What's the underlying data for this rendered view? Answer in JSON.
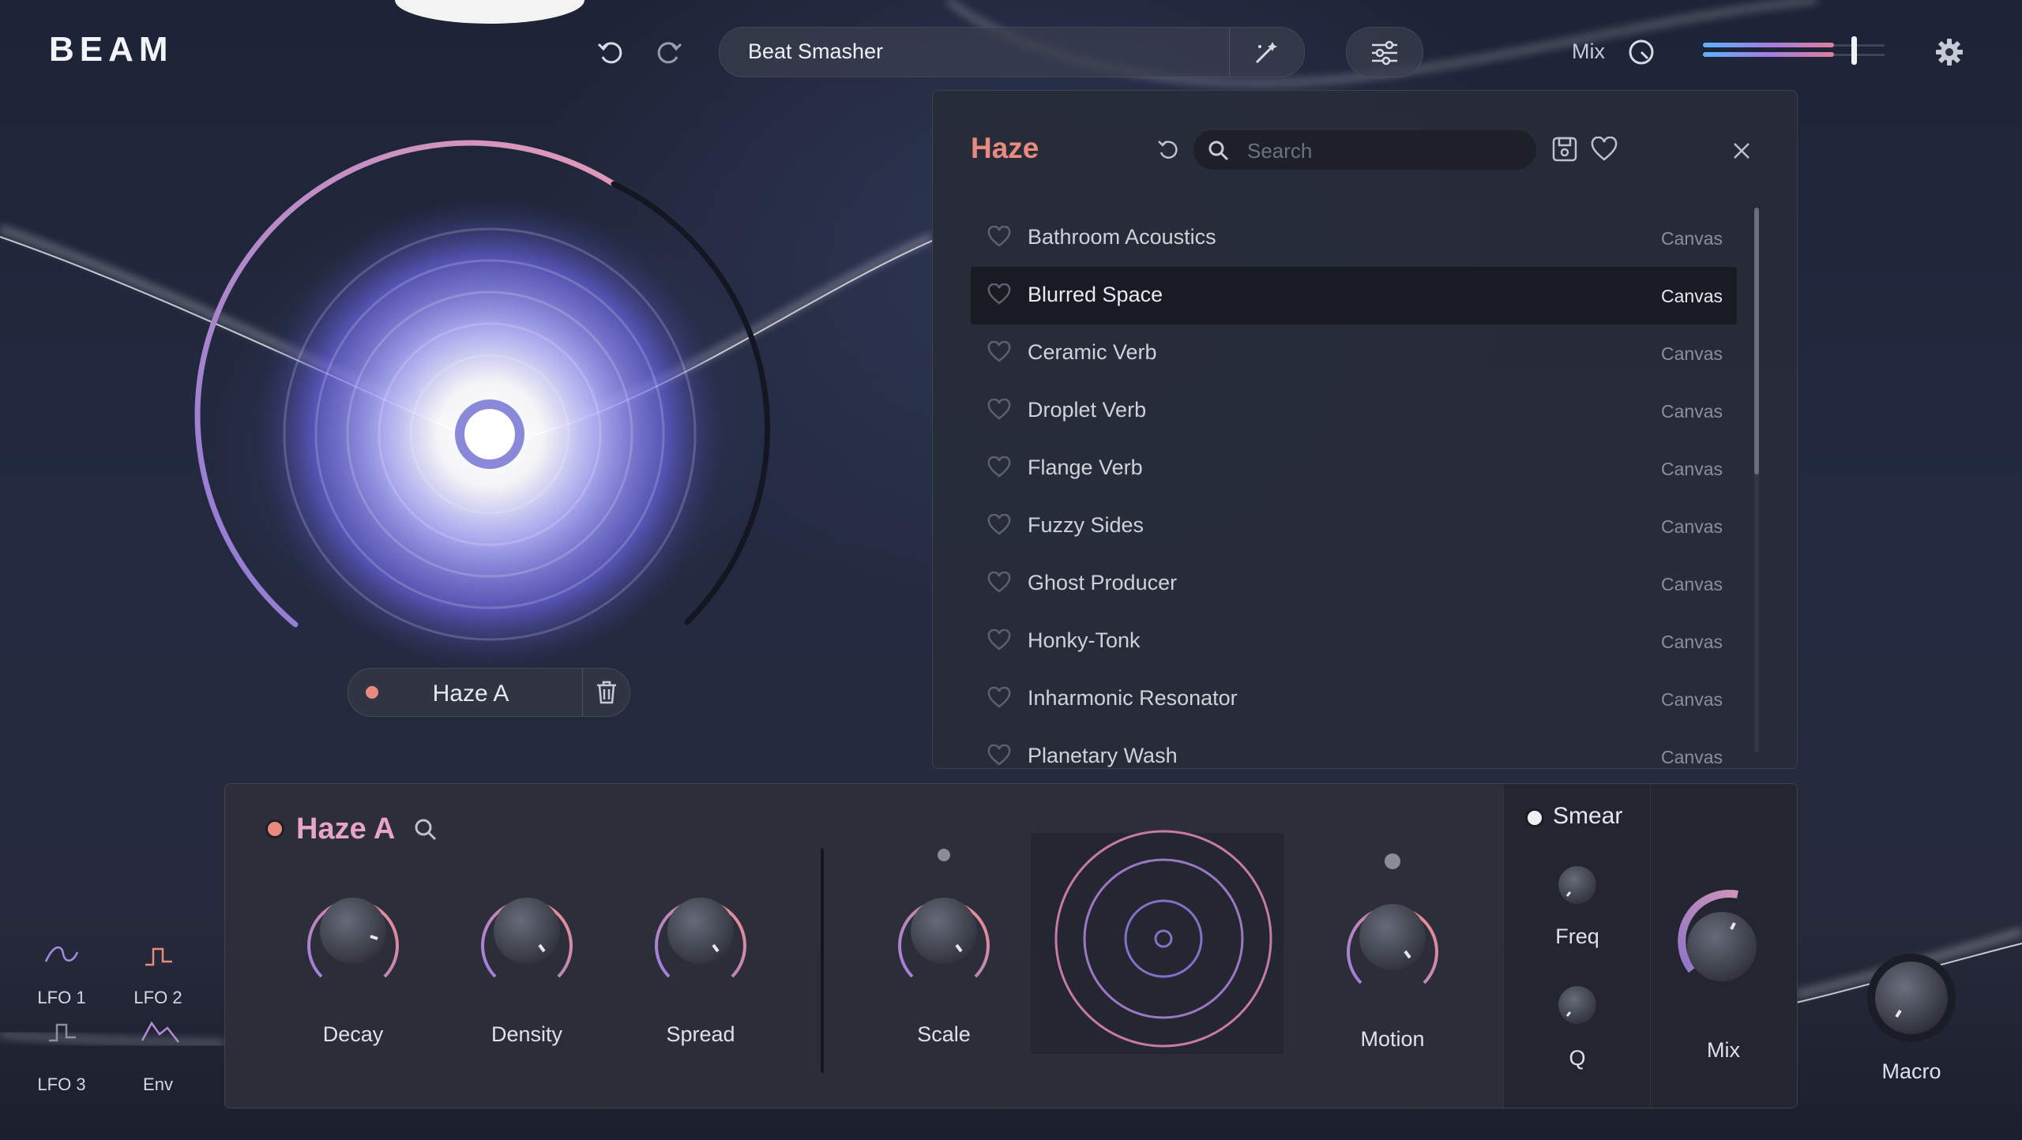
{
  "app": {
    "logo": "BEAM"
  },
  "topbar": {
    "preset_name": "Beat Smasher",
    "mix_label": "Mix",
    "mix_level": 0.85,
    "icons": [
      "undo-icon",
      "redo-icon",
      "magic-wand-icon",
      "sliders-icon",
      "mix-dial-icon",
      "gear-icon"
    ]
  },
  "visualizer": {
    "module_name": "Haze A"
  },
  "browser": {
    "title": "Haze",
    "search_placeholder": "Search",
    "items": [
      {
        "name": "Bathroom Acoustics",
        "tag": "Canvas",
        "selected": false
      },
      {
        "name": "Blurred Space",
        "tag": "Canvas",
        "selected": true
      },
      {
        "name": "Ceramic Verb",
        "tag": "Canvas",
        "selected": false
      },
      {
        "name": "Droplet Verb",
        "tag": "Canvas",
        "selected": false
      },
      {
        "name": "Flange Verb",
        "tag": "Canvas",
        "selected": false
      },
      {
        "name": "Fuzzy Sides",
        "tag": "Canvas",
        "selected": false
      },
      {
        "name": "Ghost Producer",
        "tag": "Canvas",
        "selected": false
      },
      {
        "name": "Honky-Tonk",
        "tag": "Canvas",
        "selected": false
      },
      {
        "name": "Inharmonic Resonator",
        "tag": "Canvas",
        "selected": false
      },
      {
        "name": "Planetary Wash",
        "tag": "Canvas",
        "selected": false
      }
    ]
  },
  "module_panel": {
    "title": "Haze A",
    "knobs": {
      "decay": "Decay",
      "density": "Density",
      "spread": "Spread",
      "scale": "Scale",
      "motion": "Motion",
      "freq": "Freq",
      "q": "Q",
      "mix": "Mix"
    },
    "smear_label": "Smear"
  },
  "modulators": {
    "lfo1": "LFO 1",
    "lfo2": "LFO 2",
    "lfo3": "LFO 3",
    "env": "Env"
  },
  "macro": {
    "label": "Macro"
  },
  "colors": {
    "accent_coral": "#e88a7e",
    "accent_purple": "#b28ae0",
    "module_title": "#e7a3c8"
  }
}
